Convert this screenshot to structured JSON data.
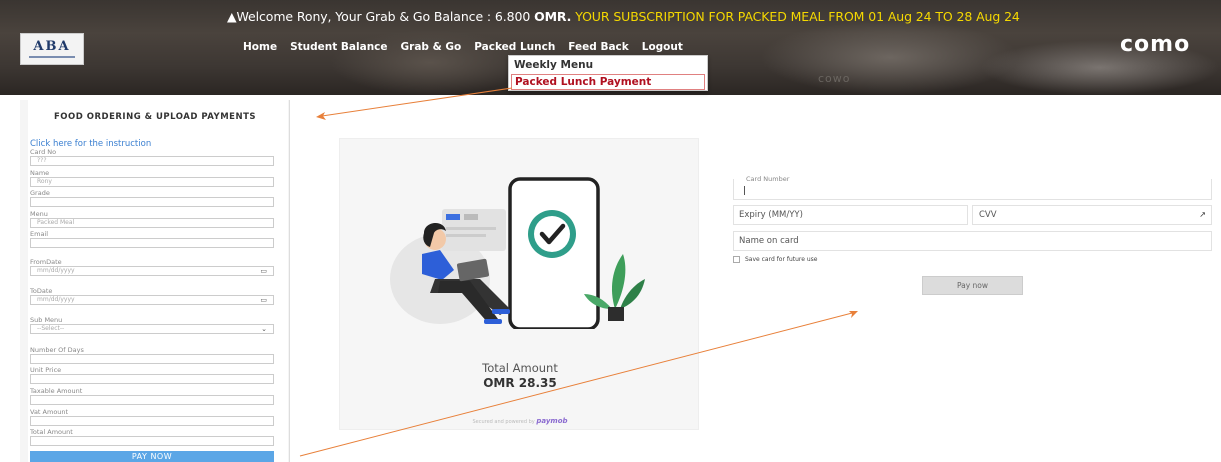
{
  "header": {
    "welcome_prefix": "Welcome Rony, Your Grab & Go Balance : 6.800 ",
    "welcome_currency": "OMR.",
    "subscription_text": " YOUR SUBSCRIPTION FOR PACKED MEAL FROM 01 Aug 24 TO 28 Aug 24",
    "logo_text": "ABA",
    "brand_right": "como",
    "brand_watermark": "cowo",
    "nav": [
      "Home",
      "Student Balance",
      "Grab & Go",
      "Packed Lunch",
      "Feed Back",
      "Logout"
    ]
  },
  "dropdown": {
    "items": [
      "Weekly Menu",
      "Packed Lunch Payment"
    ]
  },
  "left_panel": {
    "title": "FOOD ORDERING & UPLOAD PAYMENTS",
    "instruction_link": "Click here for the instruction",
    "fields": [
      {
        "label": "Card No",
        "value": "???"
      },
      {
        "label": "Name",
        "value": "Rony"
      },
      {
        "label": "Grade",
        "value": ""
      },
      {
        "label": "Menu",
        "value": "Packed Meal"
      },
      {
        "label": "Email",
        "value": ""
      },
      {
        "label": "FromDate",
        "value": "mm/dd/yyyy"
      },
      {
        "label": "ToDate",
        "value": "mm/dd/yyyy"
      },
      {
        "label": "Sub Menu",
        "value": "--Select--"
      },
      {
        "label": "Number Of Days",
        "value": ""
      },
      {
        "label": "Unit Price",
        "value": ""
      },
      {
        "label": "Taxable Amount",
        "value": ""
      },
      {
        "label": "Vat Amount",
        "value": ""
      },
      {
        "label": "Total Amount",
        "value": ""
      }
    ],
    "pay_button": "PAY NOW"
  },
  "summary": {
    "total_label": "Total Amount",
    "total_amount": "OMR 28.35",
    "secured_text": "Secured and powered by ",
    "provider": "paymob"
  },
  "payment_form": {
    "card_number_label": "Card Number",
    "expiry_placeholder": "Expiry (MM/YY)",
    "cvv_placeholder": "CVV",
    "name_placeholder": "Name on card",
    "save_card_label": "Save card for future use",
    "pay_button": "Pay now"
  },
  "colors": {
    "subscription": "#f5d800",
    "dropdown_active": "#b01020",
    "link": "#3a7fd0",
    "pay_left": "#5ba6e6",
    "annotation_arrow": "#e8803a",
    "check_circle": "#2f9e8a",
    "person_shirt": "#2d5fd8"
  }
}
